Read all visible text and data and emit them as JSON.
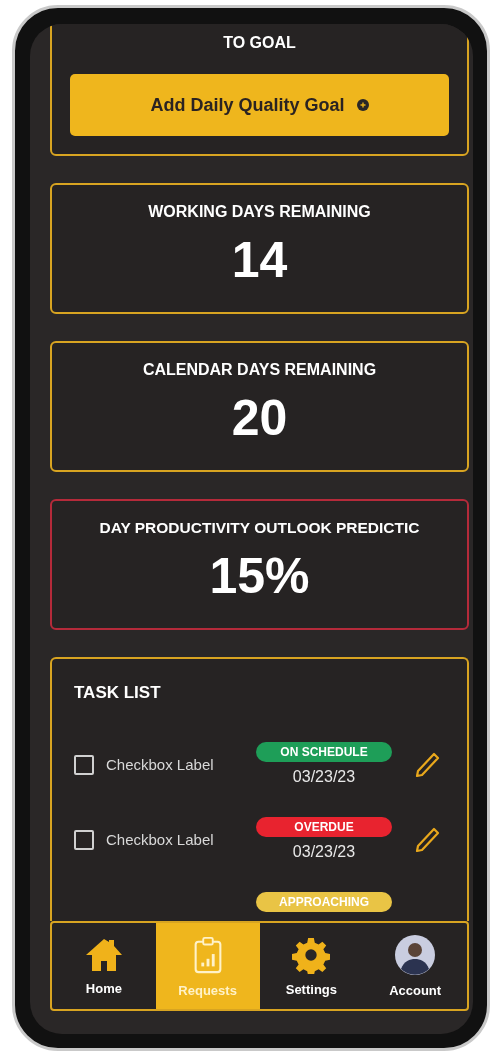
{
  "goal_card": {
    "heading": "TO GOAL",
    "button": "Add Daily Quality Goal"
  },
  "stats": [
    {
      "title": "WORKING DAYS REMAINING",
      "value": "14",
      "kind": "normal"
    },
    {
      "title": "CALENDAR DAYS REMAINING",
      "value": "20",
      "kind": "normal"
    },
    {
      "title": "DAY PRODUCTIVITY OUTLOOK PREDICTIC",
      "value": "15%",
      "kind": "alert"
    }
  ],
  "task_list": {
    "title": "TASK LIST",
    "tasks": [
      {
        "label": "Checkbox Label",
        "checked": false,
        "status": "ON SCHEDULE",
        "color": "#1e9e58",
        "date": "03/23/23"
      },
      {
        "label": "Checkbox Label",
        "checked": false,
        "status": "OVERDUE",
        "color": "#e8232f",
        "date": "03/23/23"
      },
      {
        "status": "APPROACHING",
        "color": "#e9c445"
      }
    ]
  },
  "nav": [
    {
      "label": "Home",
      "kind": "home",
      "selected": false
    },
    {
      "label": "Requests",
      "kind": "requests",
      "selected": true
    },
    {
      "label": "Settings",
      "kind": "settings",
      "selected": false
    },
    {
      "label": "Account",
      "kind": "account",
      "selected": false
    }
  ]
}
